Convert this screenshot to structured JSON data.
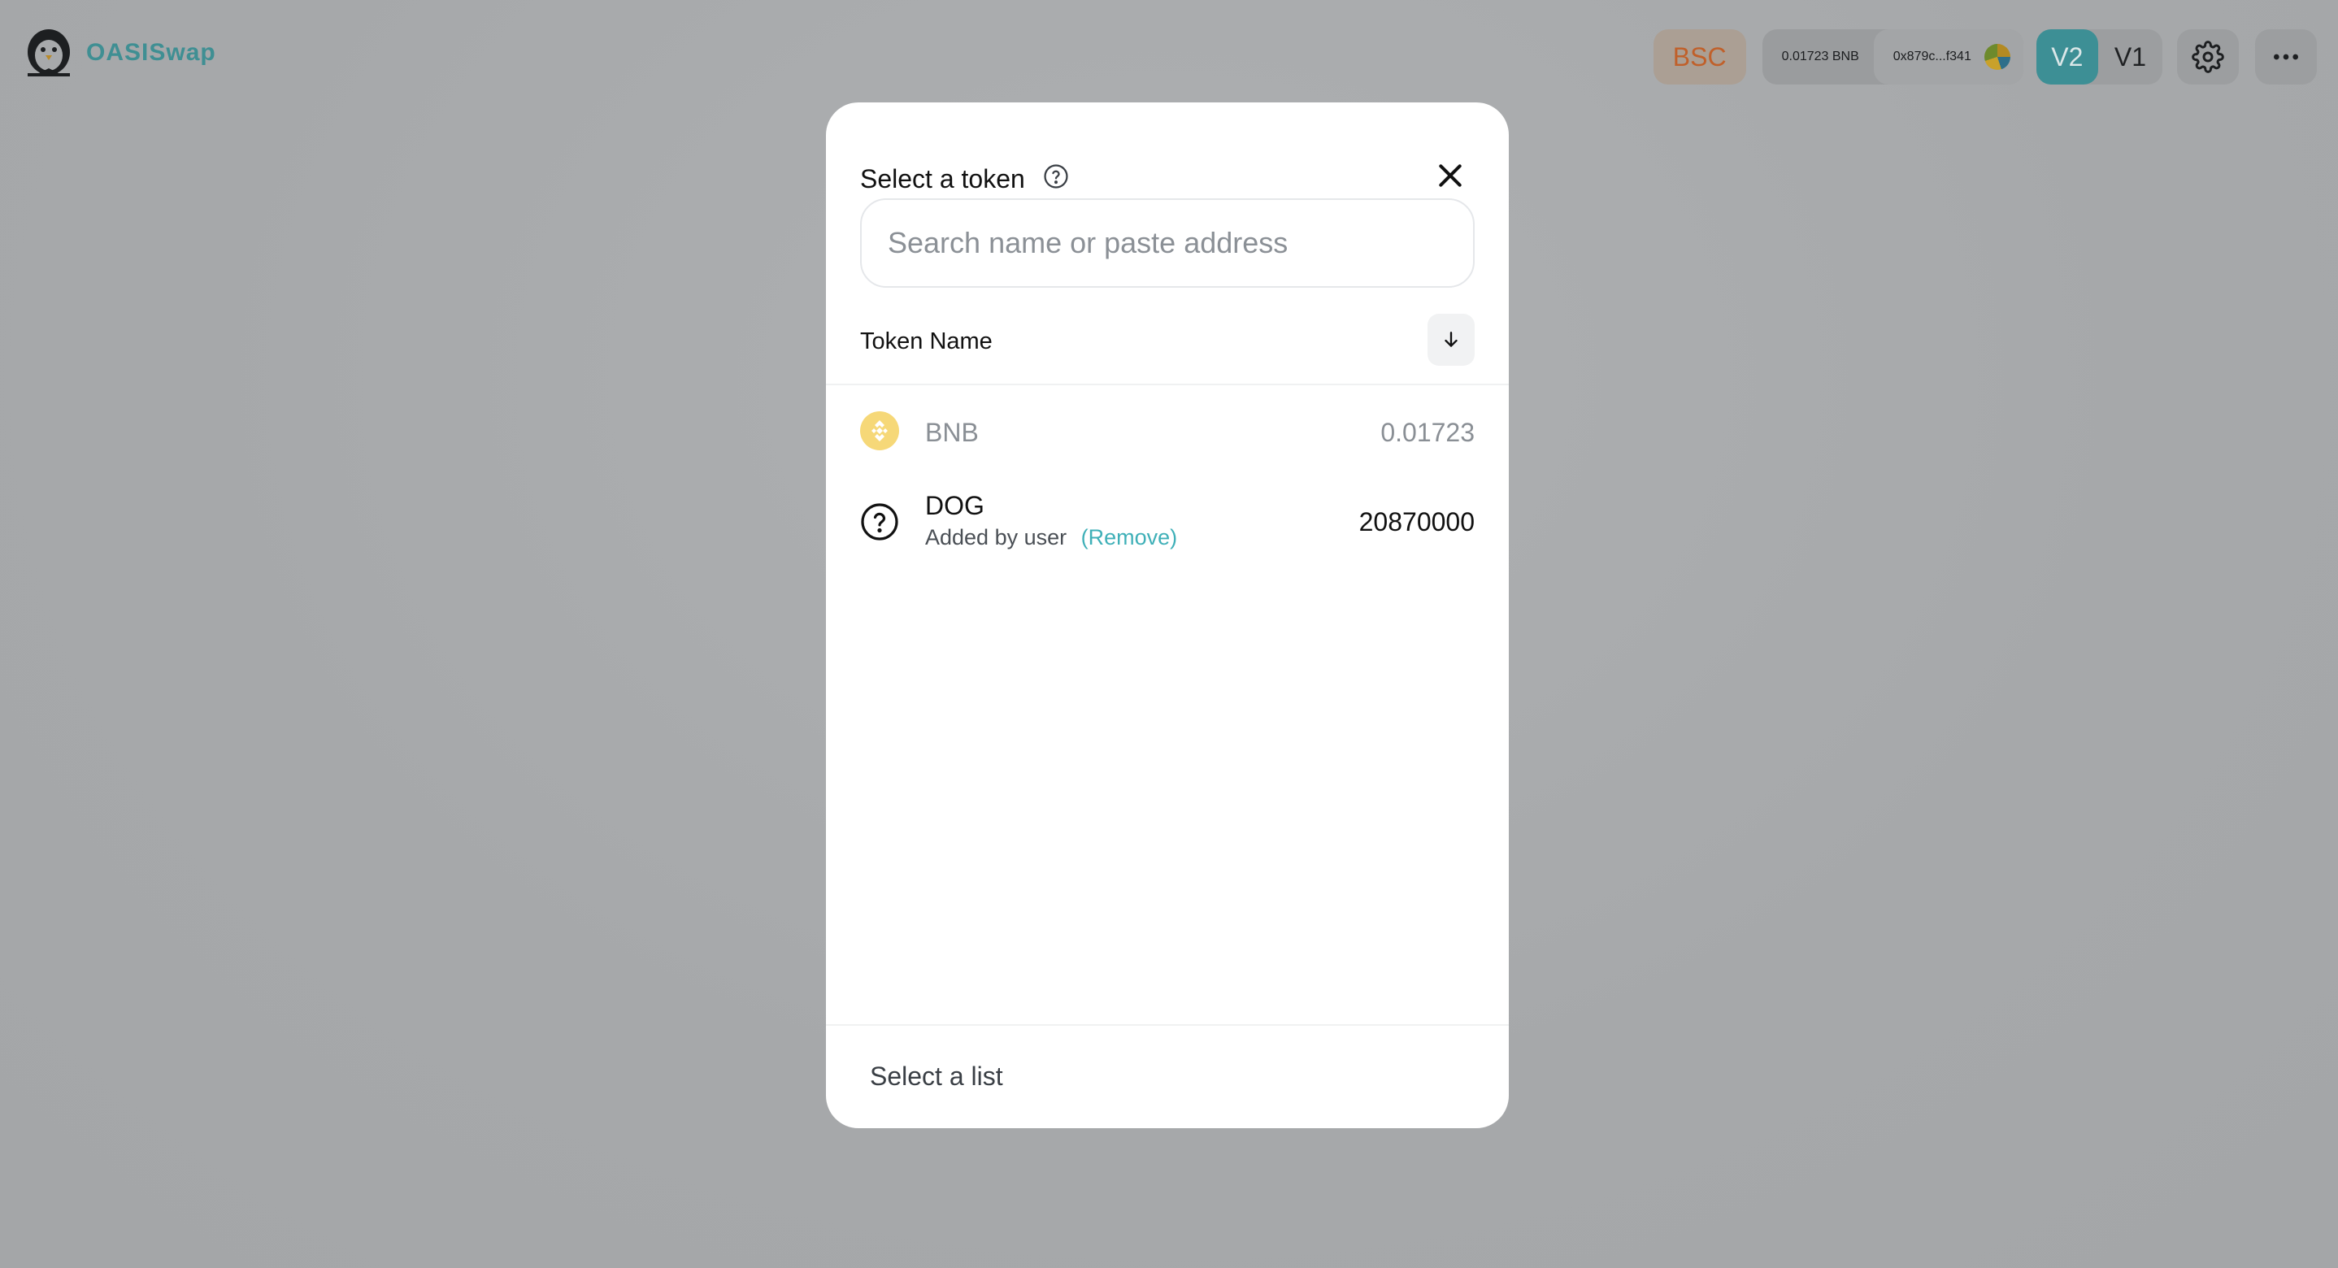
{
  "header": {
    "logo_text": "OASISwap",
    "network": "BSC",
    "balance": "0.01723 BNB",
    "address": "0x879c...f341",
    "versions": [
      "V2",
      "V1"
    ],
    "active_version": "V2"
  },
  "modal": {
    "title": "Select a token",
    "search_placeholder": "Search name or paste address",
    "list_header": "Token Name",
    "tokens": [
      {
        "symbol": "BNB",
        "balance": "0.01723",
        "icon": "bnb-coin-icon"
      },
      {
        "symbol": "DOG",
        "sub_label": "Added by user",
        "remove_label": "(Remove)",
        "balance": "20870000",
        "icon": "unknown-token-icon"
      }
    ],
    "footer_label": "Select a list"
  },
  "colors": {
    "overlay": "#a7a9ab",
    "accent": "#3d8f95",
    "link": "#3fb0b8",
    "bsc_text": "#c0602a"
  }
}
